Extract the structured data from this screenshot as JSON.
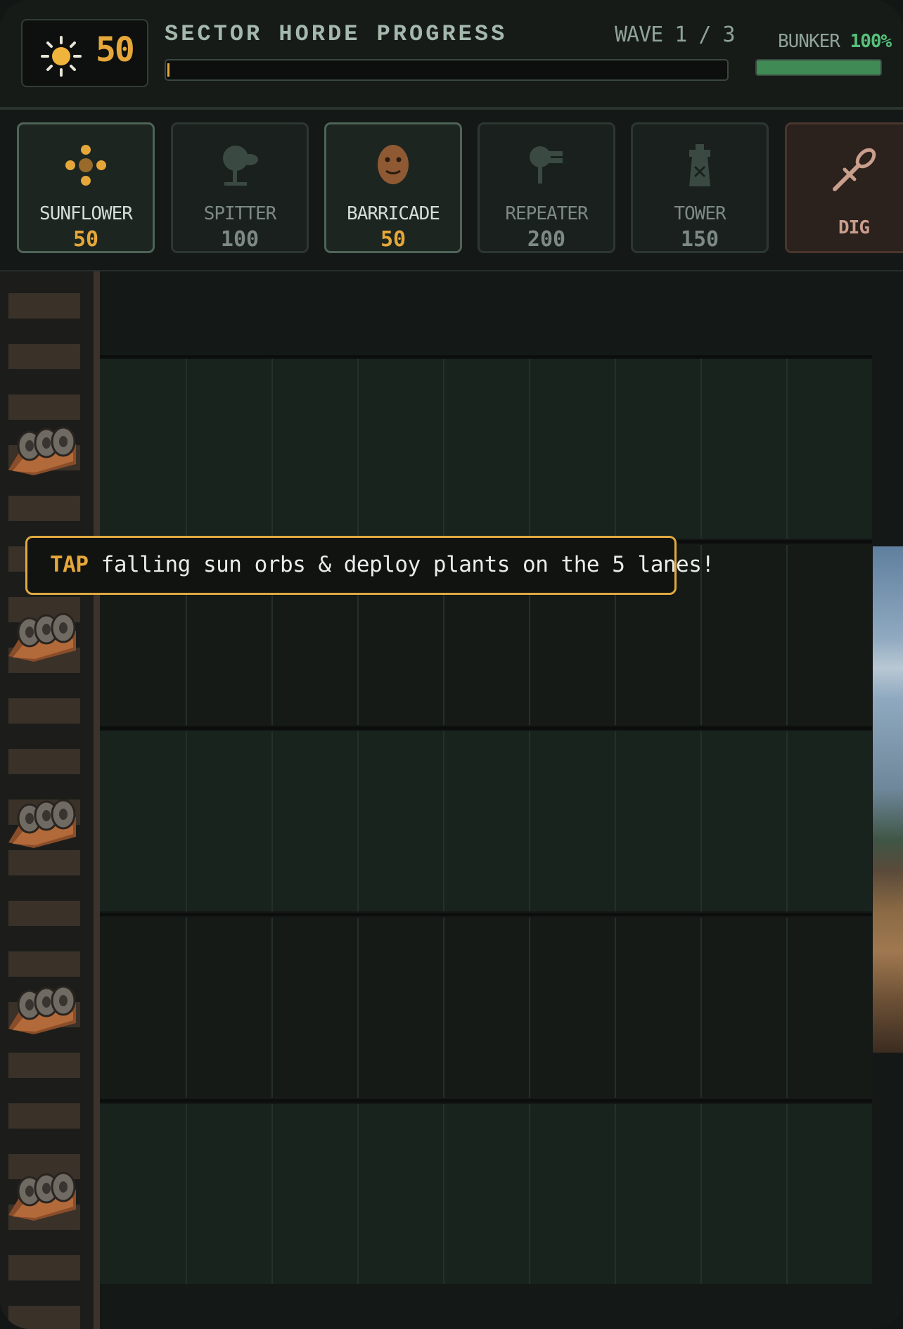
{
  "hud": {
    "sun_count": "50",
    "horde_title": "SECTOR HORDE PROGRESS",
    "wave_text": "WAVE 1 / 3",
    "horde_progress_fraction": 0.004,
    "bunker_label": "BUNKER",
    "bunker_percent": "100%",
    "bunker_fraction": 1.0,
    "colors": {
      "accent": "#e6a73a",
      "health": "#3f8a55"
    }
  },
  "cards": [
    {
      "name": "SUNFLOWER",
      "cost": "50",
      "icon": "sunflower-icon",
      "affordable": true
    },
    {
      "name": "SPITTER",
      "cost": "100",
      "icon": "spitter-icon",
      "affordable": false
    },
    {
      "name": "BARRICADE",
      "cost": "50",
      "icon": "barricade-icon",
      "affordable": true
    },
    {
      "name": "REPEATER",
      "cost": "200",
      "icon": "repeater-icon",
      "affordable": false
    },
    {
      "name": "TOWER",
      "cost": "150",
      "icon": "tower-icon",
      "affordable": false
    }
  ],
  "dig": {
    "label": "DIG",
    "icon": "shovel-icon"
  },
  "field": {
    "lanes": 5,
    "columns": 9,
    "mower_icon": "lawn-mower-icon"
  },
  "tooltip": {
    "keyword": "TAP",
    "text": " falling sun orbs & deploy plants on the 5 lanes!"
  }
}
